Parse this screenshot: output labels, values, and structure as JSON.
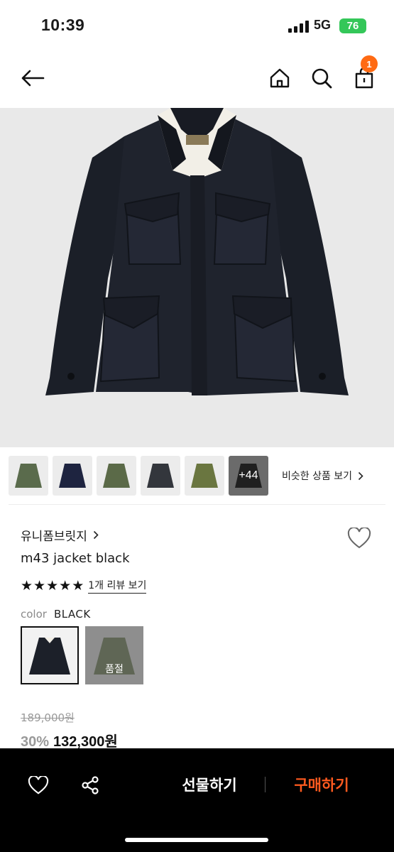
{
  "status_bar": {
    "time": "10:39",
    "network": "5G",
    "battery": "76"
  },
  "nav": {
    "cart_count": "1"
  },
  "thumbnails": {
    "more_label": "+44",
    "similar_label": "비슷한 상품 보기"
  },
  "product": {
    "brand": "유니폼브릿지",
    "name": "m43 jacket black",
    "rating": 5,
    "review_link": "1개 리뷰 보기",
    "color_label": "color",
    "color_value": "BLACK",
    "soldout_label": "품절",
    "original_price": "189,000원",
    "discount": "30%",
    "price": "132,300원"
  },
  "bottom_bar": {
    "gift_label": "선물하기",
    "buy_label": "구매하기"
  },
  "colors": {
    "accent": "#ff5a1f",
    "badge": "#ff6a13",
    "battery": "#34c759",
    "jacket": "#1c2029"
  }
}
